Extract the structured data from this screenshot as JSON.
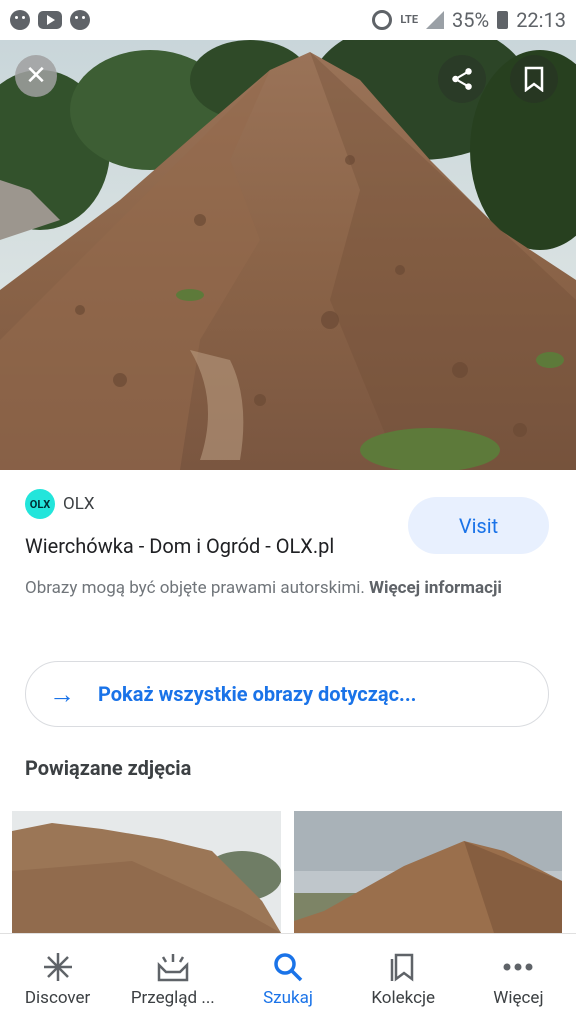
{
  "status_bar": {
    "network": "LTE",
    "battery": "35%",
    "time": "22:13",
    "icons": [
      "messenger-icon",
      "youtube-icon",
      "messenger-icon",
      "alarm-icon",
      "signal-icon",
      "battery-icon"
    ]
  },
  "hero": {
    "close_icon": "close-icon",
    "share_icon": "share-icon",
    "bookmark_icon": "bookmark-icon"
  },
  "result": {
    "source_logo_text": "OLX",
    "source_name": "OLX",
    "title": "Wierchówka - Dom i Ogród - OLX.pl",
    "visit_label": "Visit",
    "copyright_text": "Obrazy mogą być objęte prawami autorskimi.",
    "copyright_link": "Więcej informacji",
    "show_all_label": "Pokaż wszystkie obrazy dotycząc..."
  },
  "related": {
    "title": "Powiązane zdjęcia"
  },
  "bottom_nav": {
    "items": [
      {
        "label": "Discover",
        "icon": "asterisk-icon"
      },
      {
        "label": "Przegląd ...",
        "icon": "updates-icon"
      },
      {
        "label": "Szukaj",
        "icon": "search-icon"
      },
      {
        "label": "Kolekcje",
        "icon": "collections-icon"
      },
      {
        "label": "Więcej",
        "icon": "more-icon"
      }
    ],
    "active_index": 2
  },
  "colors": {
    "accent": "#1a73e8",
    "visit_bg": "#e8f0fe",
    "olx_brand": "#23e5db"
  }
}
